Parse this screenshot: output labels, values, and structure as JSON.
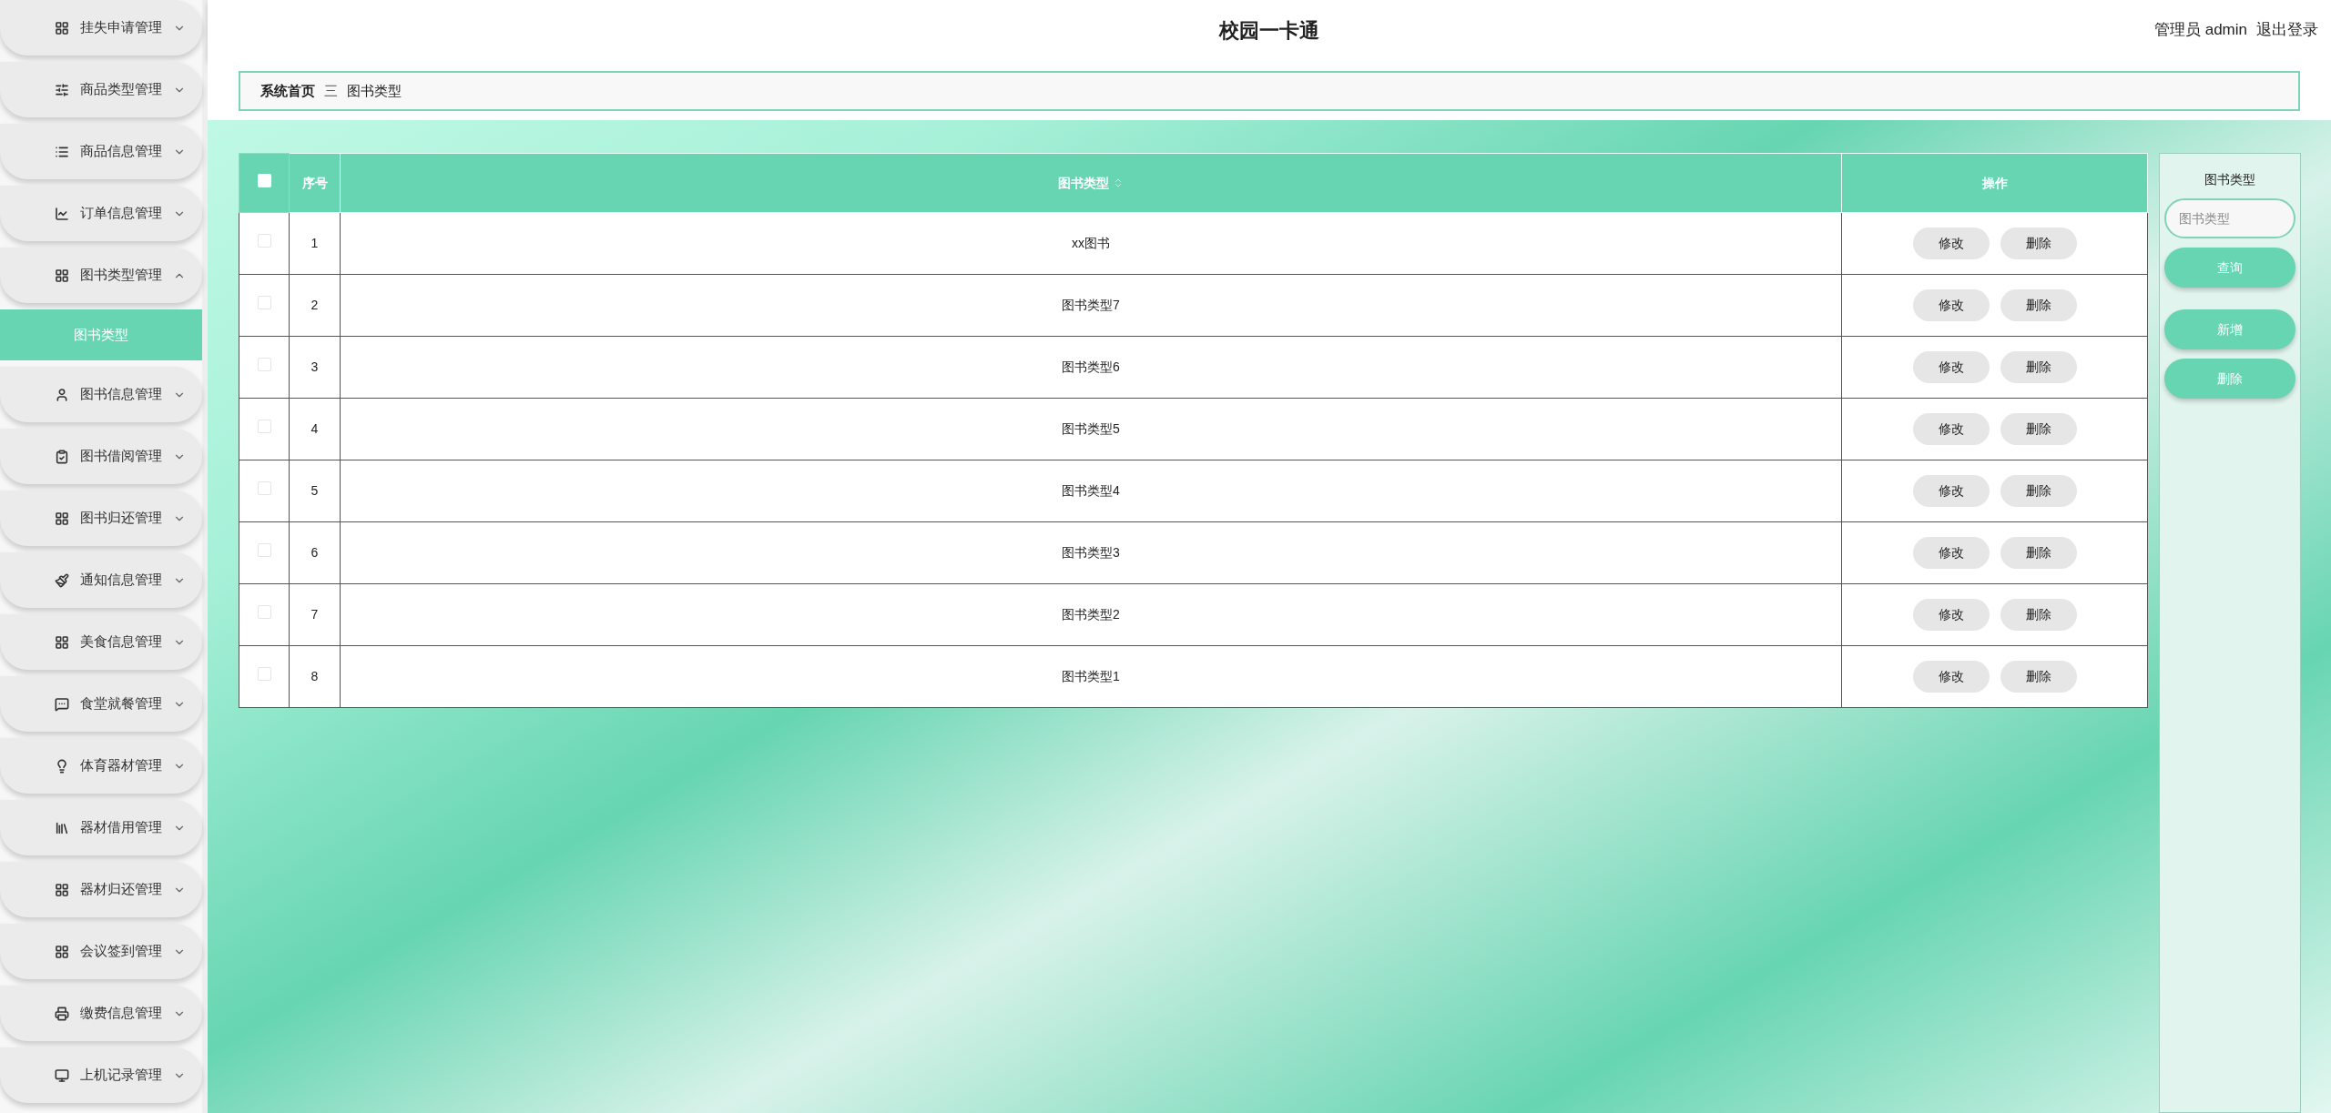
{
  "header": {
    "title": "校园一卡通",
    "user": "管理员 admin",
    "logout": "退出登录"
  },
  "sidebar": {
    "items": [
      {
        "label": "挂失申请管理",
        "expanded": false
      },
      {
        "label": "商品类型管理",
        "expanded": false
      },
      {
        "label": "商品信息管理",
        "expanded": false
      },
      {
        "label": "订单信息管理",
        "expanded": false
      },
      {
        "label": "图书类型管理",
        "expanded": true,
        "children": [
          {
            "label": "图书类型",
            "selected": true
          }
        ]
      },
      {
        "label": "图书信息管理",
        "expanded": false
      },
      {
        "label": "图书借阅管理",
        "expanded": false
      },
      {
        "label": "图书归还管理",
        "expanded": false
      },
      {
        "label": "通知信息管理",
        "expanded": false
      },
      {
        "label": "美食信息管理",
        "expanded": false
      },
      {
        "label": "食堂就餐管理",
        "expanded": false
      },
      {
        "label": "体育器材管理",
        "expanded": false
      },
      {
        "label": "器材借用管理",
        "expanded": false
      },
      {
        "label": "器材归还管理",
        "expanded": false
      },
      {
        "label": "会议签到管理",
        "expanded": false
      },
      {
        "label": "缴费信息管理",
        "expanded": false
      },
      {
        "label": "上机记录管理",
        "expanded": false
      }
    ]
  },
  "breadcrumb": {
    "home": "系统首页",
    "separator": "三",
    "current": "图书类型"
  },
  "table": {
    "select_all": {
      "checked": false
    },
    "columns": [
      "序号",
      "图书类型",
      "操作"
    ],
    "rows": [
      {
        "checked": false,
        "index": "1",
        "type": "xx图书",
        "actions": [
          "修改",
          "删除"
        ]
      },
      {
        "checked": false,
        "index": "2",
        "type": "图书类型7",
        "actions": [
          "修改",
          "删除"
        ]
      },
      {
        "checked": false,
        "index": "3",
        "type": "图书类型6",
        "actions": [
          "修改",
          "删除"
        ]
      },
      {
        "checked": false,
        "index": "4",
        "type": "图书类型5",
        "actions": [
          "修改",
          "删除"
        ]
      },
      {
        "checked": false,
        "index": "5",
        "type": "图书类型4",
        "actions": [
          "修改",
          "删除"
        ]
      },
      {
        "checked": false,
        "index": "6",
        "type": "图书类型3",
        "actions": [
          "修改",
          "删除"
        ]
      },
      {
        "checked": false,
        "index": "7",
        "type": "图书类型2",
        "actions": [
          "修改",
          "删除"
        ]
      },
      {
        "checked": false,
        "index": "8",
        "type": "图书类型1",
        "actions": [
          "修改",
          "删除"
        ]
      }
    ]
  },
  "search_panel": {
    "label": "图书类型",
    "placeholder": "图书类型",
    "buttons": [
      "查询",
      "新增",
      "删除"
    ]
  }
}
